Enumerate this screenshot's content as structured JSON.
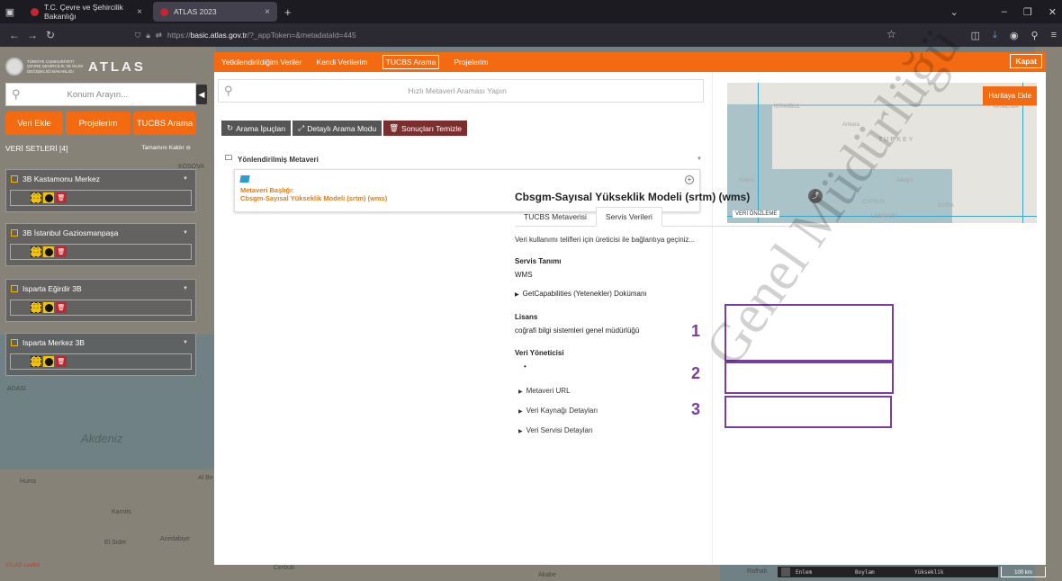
{
  "browser": {
    "tabs": [
      {
        "label": "T.C. Çevre ve Şehircilik Bakanlığı"
      },
      {
        "label": "ATLAS 2023"
      }
    ],
    "url_prefix": "https://",
    "url_domain": "basic.atlas.gov.tr",
    "url_path": "/?_appToken=&metadataId=445"
  },
  "map": {
    "labels": [
      "Akdeniz",
      "ADASI",
      "Karnits",
      "El Sider",
      "Acedabiye",
      "Hums",
      "Cerbub",
      "Akabe",
      "Rafhah",
      "KOSOVA",
      "Al Be"
    ],
    "attribution": "ATLAS Leaflet",
    "status": {
      "lat": "Enlem",
      "lon": "Boylam",
      "elev": "Yükseklik"
    },
    "scale": "100 km"
  },
  "sidebar": {
    "logo_text": "TÜRKİYE CUMHURİYETİ ÇEVRE ŞEHİRCİLİK VE İKLİM DEĞİŞİKLİĞİ BAKANLIĞI",
    "logo_brand": "ATLAS",
    "search_placeholder": "Konum Arayın...",
    "buttons": [
      "Veri Ekle",
      "Projelerim",
      "TUCBS Arama"
    ],
    "datasets_title": "VERİ SETLERİ [4]",
    "remove_all": "Tamamını Kaldır",
    "layers": [
      {
        "name": "3B Kastamonu Merkez"
      },
      {
        "name": "3B İstanbul Gaziosmanpaşa"
      },
      {
        "name": "Isparta Eğirdir 3B"
      },
      {
        "name": "Isparta Merkez 3B"
      }
    ]
  },
  "modal": {
    "tabs": [
      "Yetkilendirildiğim Veriler",
      "Kendi Verilerim",
      "TUCBS Arama",
      "Projelerim"
    ],
    "active_tab": "TUCBS Arama",
    "close": "Kapat",
    "search_placeholder": "Hızlı Metaveri Araması Yapın",
    "actions": [
      "Arama İpuçları",
      "Detaylı Arama Modu",
      "Sonuçları Temizle"
    ],
    "group_title": "Yönlendirilmiş Metaveri",
    "result": {
      "title_label": "Metaveri Başlığı:",
      "title_value": "Cbsgm-Sayısal Yükseklik Modeli (srtm) (wms)"
    }
  },
  "detail": {
    "preview_button": "Haritaya Ekle",
    "preview_label": "VERİ ÖNİZLEME",
    "preview_places": [
      "İSTANBUL",
      "ARMENIA",
      "Ankara",
      "TURKEY",
      "Kıbrıs",
      "Aleppo",
      "CYPRUS",
      "SYRIA",
      "LEBANON"
    ],
    "title": "Cbsgm-Sayısal Yükseklik Modeli (srtm) (wms)",
    "tabs": [
      "TUCBS Metaverisi",
      "Servis Verileri"
    ],
    "active_tab": "Servis Verileri",
    "contact_note": "Veri kullanımı telifleri için üreticisi ile bağlantıya geçiniz...",
    "sections": [
      {
        "number": "1",
        "title": "Servis Tanımı",
        "value": "WMS",
        "sub": "GetCapabilities (Yetenekler) Dokümanı"
      },
      {
        "number": "2",
        "title": "Lisans",
        "value": "coğrafi bilgi sistemleri genel müdürlüğü"
      },
      {
        "number": "3",
        "title": "Veri Yöneticisi",
        "value": "•"
      }
    ],
    "expanders": [
      "Metaveri URL",
      "Veri Kaynağı Detayları",
      "Veri Servisi Detayları"
    ],
    "watermark": "Genel Müdürlüğü"
  },
  "colors": {
    "accent": "#f46a10",
    "highlight_box": "#7a3ea0",
    "link": "#e37c1a"
  }
}
